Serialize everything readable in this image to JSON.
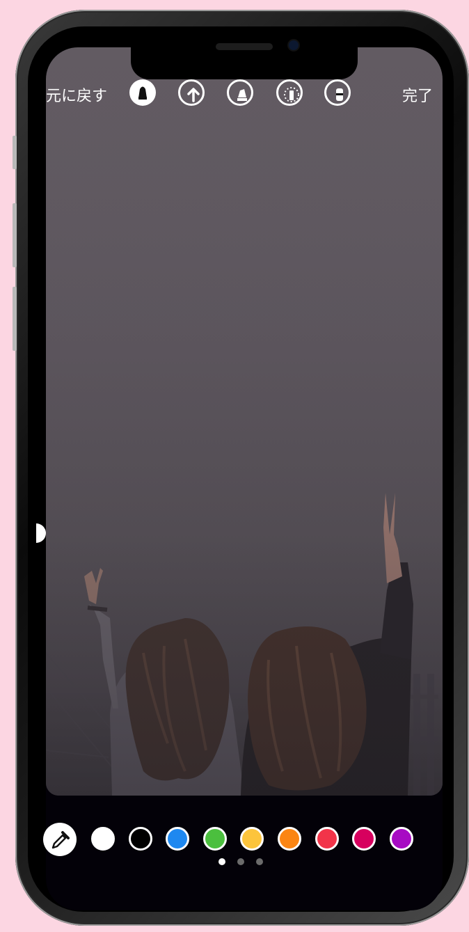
{
  "toolbar": {
    "undo_label": "元に戻す",
    "done_label": "完了",
    "tools": [
      {
        "icon": "pen-tool-icon",
        "selected": true
      },
      {
        "icon": "arrow-tool-icon",
        "selected": false
      },
      {
        "icon": "marker-tool-icon",
        "selected": false
      },
      {
        "icon": "neon-tool-icon",
        "selected": false
      },
      {
        "icon": "eraser-tool-icon",
        "selected": false
      }
    ]
  },
  "palette": {
    "colors": [
      "#ffffff",
      "#000000",
      "#1e88f0",
      "#4bbf3e",
      "#fcc43c",
      "#fb8513",
      "#f23449",
      "#d7005e",
      "#a70bc3"
    ],
    "page_count": 3,
    "current_page": 1
  }
}
